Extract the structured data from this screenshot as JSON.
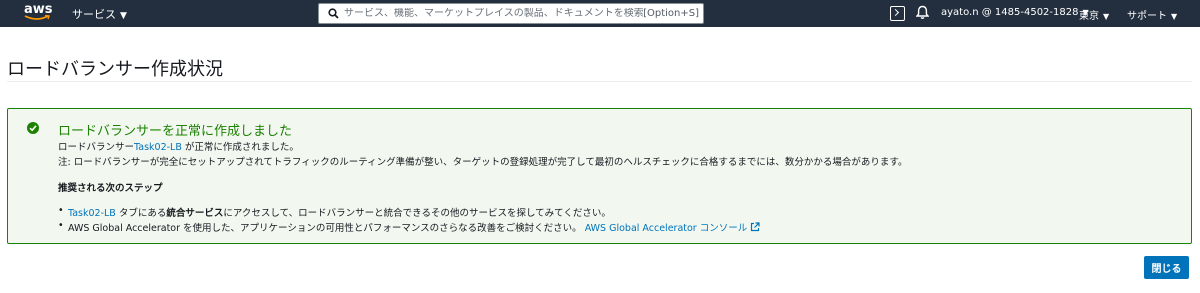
{
  "nav": {
    "logo_text": "aws",
    "services_label": "サービス",
    "search_placeholder": "サービス、機能、マーケットプレイスの製品、ドキュメントを検索",
    "search_shortcut": "[Option+S]",
    "account": "ayato.n @ 1485-4502-1828",
    "region": "東京",
    "support": "サポート"
  },
  "page": {
    "title": "ロードバランサー作成状況"
  },
  "alert": {
    "title": "ロードバランサーを正常に作成しました",
    "line1_prefix": "ロードバランサー",
    "line1_link": "Task02-LB",
    "line1_suffix": " が正常に作成されました。",
    "note": "注: ロードバランサーが完全にセットアップされてトラフィックのルーティング準備が整い、ターゲットの登録処理が完了して最初のヘルスチェックに合格するまでには、数分かかる場合があります。",
    "steps_heading": "推奨される次のステップ",
    "step1_link": "Task02-LB",
    "step1_mid": " タブにある",
    "step1_bold": "統合サービス",
    "step1_suffix": "にアクセスして、ロードバランサーと統合できるその他のサービスを探してみてください。",
    "step2_text": "AWS Global Accelerator を使用した、アプリケーションの可用性とパフォーマンスのさらなる改善をご検討ください。 ",
    "step2_link": "AWS Global Accelerator コンソール"
  },
  "actions": {
    "close_label": "閉じる"
  },
  "colors": {
    "nav_bg": "#232f3e",
    "success": "#1d8102",
    "link": "#0073bb",
    "primary_button": "#0073bb"
  }
}
